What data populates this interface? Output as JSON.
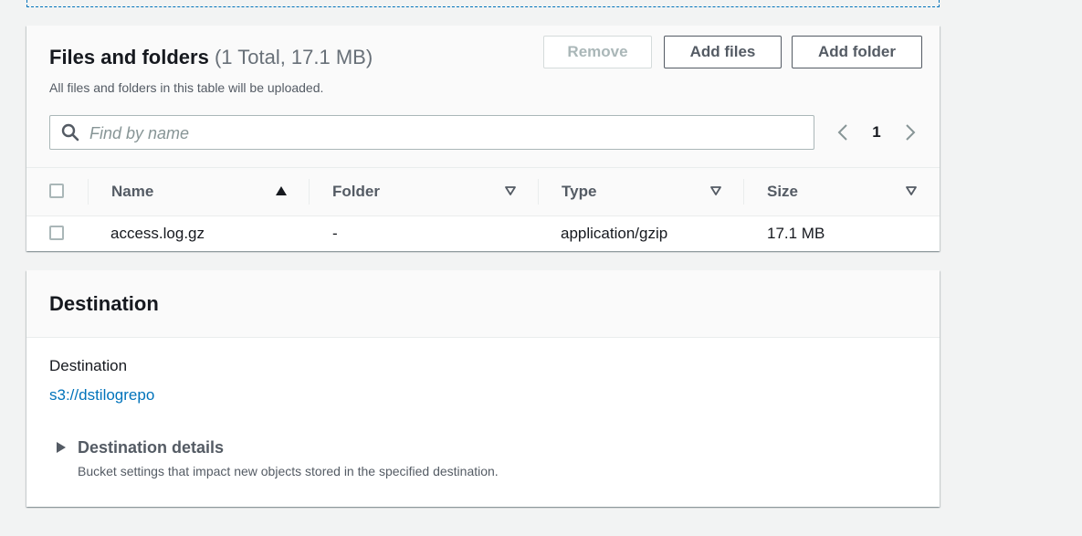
{
  "files_panel": {
    "title": "Files and folders",
    "count_label": "(1 Total, 17.1 MB)",
    "description": "All files and folders in this table will be uploaded.",
    "buttons": {
      "remove": "Remove",
      "add_files": "Add files",
      "add_folder": "Add folder"
    },
    "search": {
      "placeholder": "Find by name",
      "icon": "search-icon"
    },
    "pagination": {
      "current_page": "1"
    },
    "table": {
      "columns": [
        "Name",
        "Folder",
        "Type",
        "Size"
      ],
      "sorted_column": "Name",
      "sort_direction": "ascending",
      "rows": [
        {
          "name": "access.log.gz",
          "folder": "-",
          "type": "application/gzip",
          "size": "17.1 MB"
        }
      ]
    }
  },
  "destination_panel": {
    "title": "Destination",
    "label": "Destination",
    "link": "s3://dstilogrepo",
    "details": {
      "label": "Destination details",
      "description": "Bucket settings that impact new objects stored in the specified destination."
    }
  },
  "colors": {
    "link": "#0073bb",
    "background": "#f2f3f3",
    "text": "#16191f",
    "muted_text": "#545b64",
    "disabled": "#aab7b8"
  }
}
